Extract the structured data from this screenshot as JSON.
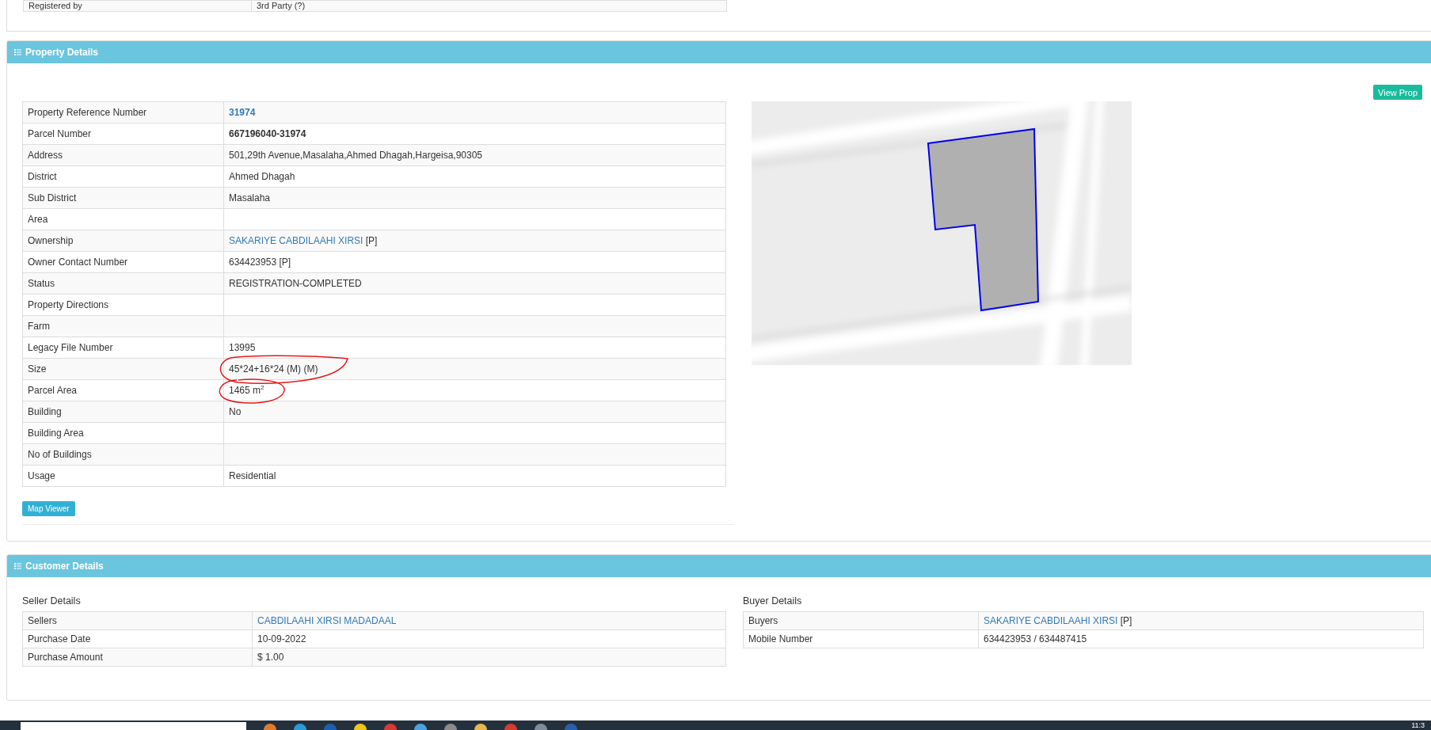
{
  "previous_section": {
    "rows": [
      {
        "label": "Registered by",
        "value": "3rd Party (?)"
      }
    ]
  },
  "property_details": {
    "title": "Property Details",
    "view_button": "View Prop",
    "map_viewer_button": "Map Viewer",
    "rows": [
      {
        "label": "Property Reference Number",
        "value": "31974",
        "kind": "reference",
        "annotated": false
      },
      {
        "label": "Parcel Number",
        "value": "667196040-31974",
        "kind": "number",
        "annotated": false
      },
      {
        "label": "Address",
        "value": "501,29th Avenue,Masalaha,Ahmed Dhagah,Hargeisa,90305",
        "kind": "text",
        "annotated": false
      },
      {
        "label": "District",
        "value": "Ahmed Dhagah",
        "kind": "text",
        "annotated": false
      },
      {
        "label": "Sub District",
        "value": "Masalaha",
        "kind": "text",
        "annotated": false
      },
      {
        "label": "Area",
        "annotated": false
      },
      {
        "label": "Ownership",
        "value": "SAKARIYE CABDILAAHI XIRSI",
        "suffix": "[P]",
        "kind": "person",
        "annotated": false
      },
      {
        "label": "Owner Contact Number",
        "value": "634423953 [P]",
        "kind": "text",
        "annotated": false
      },
      {
        "label": "Status",
        "value": "REGISTRATION-COMPLETED",
        "kind": "text",
        "annotated": false
      },
      {
        "label": "Property Directions",
        "annotated": false
      },
      {
        "label": "Farm",
        "annotated": false
      },
      {
        "label": "Legacy File Number",
        "value": "13995",
        "kind": "text",
        "annotated": false
      },
      {
        "label": "Size",
        "value": "45*24+16*24 (M) (M)",
        "kind": "text",
        "annotated": true
      },
      {
        "label": "Parcel Area",
        "value": "1465 m$^{2}$",
        "kind": "text",
        "annotated": true
      },
      {
        "label": "Building",
        "value": "No",
        "kind": "text",
        "annotated": false
      },
      {
        "label": "Building Area",
        "annotated": false
      },
      {
        "label": "No of Buildings",
        "annotated": false
      },
      {
        "label": "Usage",
        "value": "Residential",
        "kind": "text",
        "annotated": false
      }
    ]
  },
  "customer_details": {
    "title": "Customer Details",
    "seller": {
      "title": "Seller Details",
      "rows": [
        {
          "label": "Sellers",
          "value": "CABDILAAHI XIRSI MADADAAL",
          "kind": "person"
        },
        {
          "label": "Purchase Date",
          "value": "10-09-2022",
          "kind": "text"
        },
        {
          "label": "Purchase Amount",
          "value": "$ 1.00",
          "kind": "text"
        }
      ]
    },
    "buyer": {
      "title": "Buyer Details",
      "rows": [
        {
          "label": "Buyers",
          "value": "SAKARIYE CABDILAAHI XIRSI",
          "suffix": "[P]",
          "kind": "person"
        },
        {
          "label": "Mobile Number",
          "value": "634423953 / 634487415",
          "kind": "text"
        }
      ]
    }
  },
  "taskbar": {
    "clock": "11:3"
  }
}
